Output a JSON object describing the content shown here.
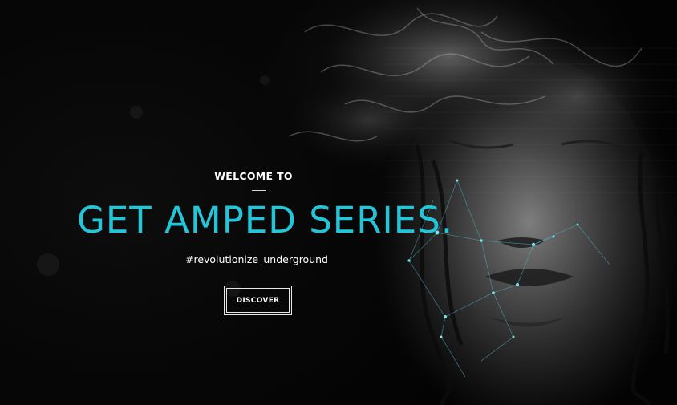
{
  "hero": {
    "welcome": "WELCOME TO",
    "headline": "GET AMPED SERIES.",
    "tagline": "#revolutionize_underground",
    "button_label": "DISCOVER"
  },
  "background_image": {
    "icon": "smoke-face-artwork"
  },
  "colors": {
    "accent": "#22c6d8",
    "text": "#ffffff",
    "background": "#050505"
  }
}
